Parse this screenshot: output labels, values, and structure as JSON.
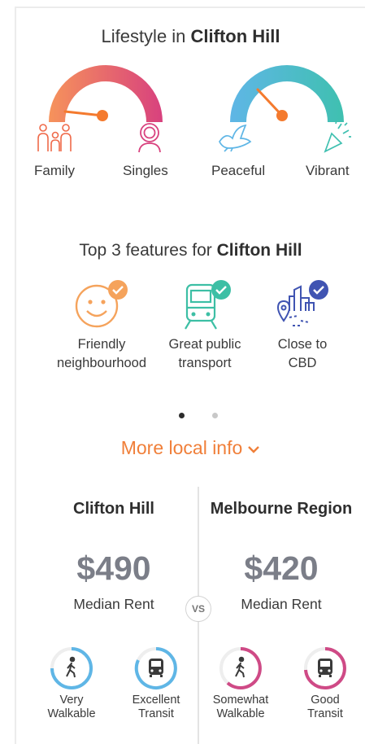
{
  "lifestyle": {
    "title_prefix": "Lifestyle in ",
    "suburb": "Clifton Hill",
    "gauges": [
      {
        "left_label": "Family",
        "right_label": "Singles",
        "left_icon": "family-icon",
        "right_icon": "single-person-icon",
        "colors": [
          "#f6935b",
          "#d8417e"
        ]
      },
      {
        "left_label": "Peaceful",
        "right_label": "Vibrant",
        "left_icon": "dove-icon",
        "right_icon": "party-popper-icon",
        "colors": [
          "#5fb6e6",
          "#3fc0b0"
        ]
      }
    ]
  },
  "features": {
    "title_prefix": "Top 3 features for ",
    "suburb": "Clifton Hill",
    "items": [
      {
        "line1": "Friendly",
        "line2": "neighbourhood",
        "icon": "smiley-icon",
        "check_color": "#f5a35c"
      },
      {
        "line1": "Great public",
        "line2": "transport",
        "icon": "train-icon",
        "check_color": "#3dbfa5"
      },
      {
        "line1": "Close to",
        "line2": "CBD",
        "icon": "city-icon",
        "check_color": "#4054b2"
      }
    ]
  },
  "more_local_info": {
    "label": "More local info"
  },
  "comparison": {
    "vs_label": "VS",
    "left": {
      "title": "Clifton Hill",
      "price": "$490",
      "median_label": "Median Rent",
      "scores": [
        {
          "line1": "Very",
          "line2": "Walkable",
          "icon": "walk-icon",
          "color": "#5fb6e6"
        },
        {
          "line1": "Excellent",
          "line2": "Transit",
          "icon": "bus-icon",
          "color": "#5fb6e6"
        }
      ]
    },
    "right": {
      "title": "Melbourne Region",
      "price": "$420",
      "median_label": "Median Rent",
      "scores": [
        {
          "line1": "Somewhat",
          "line2": "Walkable",
          "icon": "walk-icon",
          "color": "#cf4a86"
        },
        {
          "line1": "Good",
          "line2": "Transit",
          "icon": "bus-icon",
          "color": "#cf4a86"
        }
      ]
    }
  }
}
